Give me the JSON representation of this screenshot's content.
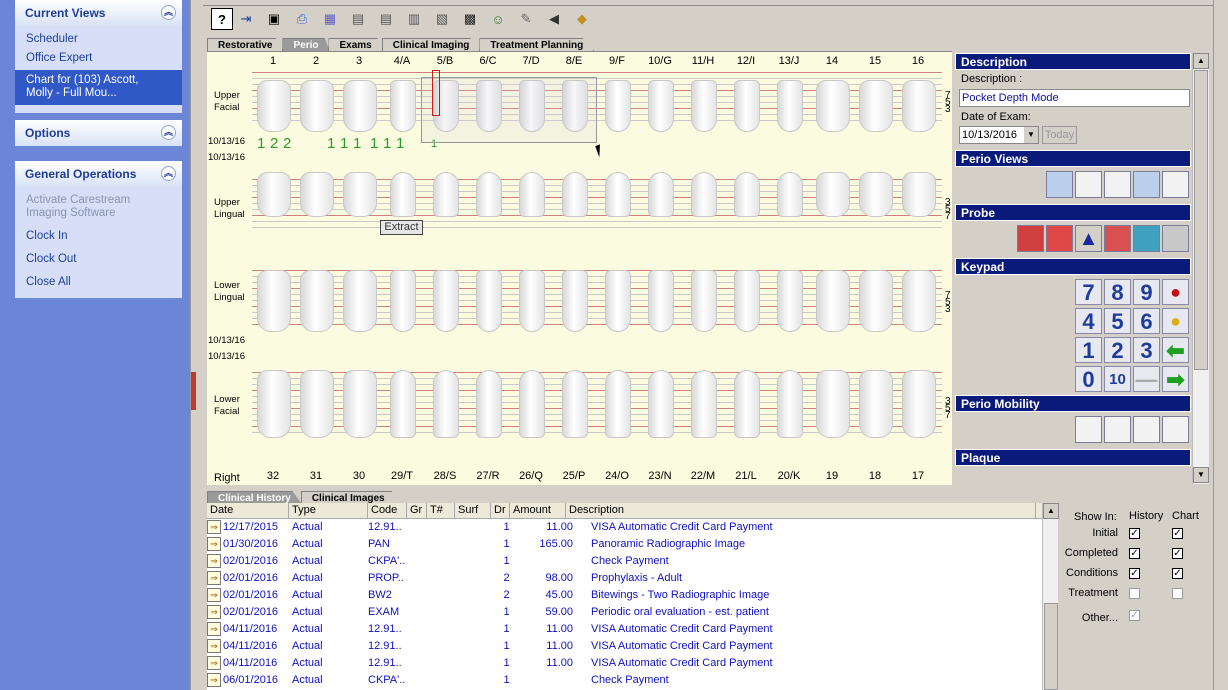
{
  "sidebar": {
    "current_views": {
      "title": "Current Views",
      "items": [
        "Scheduler",
        "Office Expert",
        "Chart for (103) Ascott, Molly - Full Mou..."
      ]
    },
    "options": {
      "title": "Options"
    },
    "general_operations": {
      "title": "General Operations",
      "items": [
        "Activate Carestream Imaging Software",
        "Clock In",
        "Clock Out",
        "Close All"
      ]
    }
  },
  "toolbar": {
    "help": "?"
  },
  "chart_tabs": [
    "Restorative",
    "Perio",
    "Exams",
    "Clinical Imaging",
    "Treatment Planning"
  ],
  "chart": {
    "upper_numbers": [
      "1",
      "2",
      "3",
      "4/A",
      "5/B",
      "6/C",
      "7/D",
      "8/E",
      "9/F",
      "10/G",
      "11/H",
      "12/I",
      "13/J",
      "14",
      "15",
      "16"
    ],
    "lower_numbers": [
      "32",
      "31",
      "30",
      "29/T",
      "28/S",
      "27/R",
      "26/Q",
      "25/P",
      "24/O",
      "23/N",
      "22/M",
      "21/L",
      "20/K",
      "19",
      "18",
      "17"
    ],
    "right_label": "Right",
    "upper_facial": "Upper\nFacial",
    "upper_lingual": "Upper\nLingual",
    "lower_lingual": "Lower\nLingual",
    "lower_facial": "Lower\nFacial",
    "dates": [
      "10/13/16",
      "10/13/16",
      "10/13/16",
      "10/13/16"
    ],
    "green_numbers": [
      "1",
      "2",
      "2",
      "1",
      "1",
      "1",
      "1",
      "1",
      "1",
      "1"
    ],
    "right_nums_a": [
      "7",
      "5",
      "3"
    ],
    "right_nums_b": [
      "3",
      "5",
      "7"
    ],
    "extract": "Extract"
  },
  "right_panel": {
    "description_title": "Description",
    "description_label": "Description :",
    "description_value": "Pocket Depth Mode",
    "date_label": "Date of Exam:",
    "date_value": "10/13/2016",
    "today_label": "Today",
    "perio_views": "Perio Views",
    "probe": "Probe",
    "keypad": "Keypad",
    "keys": [
      "7",
      "8",
      "9",
      "4",
      "5",
      "6",
      "1",
      "2",
      "3",
      "0",
      "10"
    ],
    "perio_mobility": "Perio Mobility",
    "plaque": "Plaque"
  },
  "history_tabs": [
    "Clinical History",
    "Clinical Images"
  ],
  "history": {
    "columns": [
      "Date",
      "Type",
      "Code",
      "Gr",
      "T#",
      "Surf",
      "Dr",
      "Amount",
      "Description"
    ],
    "rows": [
      [
        "12/17/2015",
        "Actual",
        "12.91..",
        "",
        "",
        "",
        "1",
        "11.00",
        "VISA Automatic Credit Card Payment"
      ],
      [
        "01/30/2016",
        "Actual",
        "PAN",
        "",
        "",
        "",
        "1",
        "165.00",
        "Panoramic Radiographic Image"
      ],
      [
        "02/01/2016",
        "Actual",
        "CKPA'..",
        "",
        "",
        "",
        "1",
        "",
        "Check Payment"
      ],
      [
        "02/01/2016",
        "Actual",
        "PROP..",
        "",
        "",
        "",
        "2",
        "98.00",
        "Prophylaxis - Adult"
      ],
      [
        "02/01/2016",
        "Actual",
        "BW2",
        "",
        "",
        "",
        "2",
        "45.00",
        "Bitewings - Two Radiographic Image"
      ],
      [
        "02/01/2016",
        "Actual",
        "EXAM",
        "",
        "",
        "",
        "1",
        "59.00",
        "Periodic oral evaluation - est. patient"
      ],
      [
        "04/11/2016",
        "Actual",
        "12.91..",
        "",
        "",
        "",
        "1",
        "11.00",
        "VISA Automatic Credit Card Payment"
      ],
      [
        "04/11/2016",
        "Actual",
        "12.91..",
        "",
        "",
        "",
        "1",
        "11.00",
        "VISA Automatic Credit Card Payment"
      ],
      [
        "04/11/2016",
        "Actual",
        "12.91..",
        "",
        "",
        "",
        "1",
        "11.00",
        "VISA Automatic Credit Card Payment"
      ],
      [
        "06/01/2016",
        "Actual",
        "CKPA'..",
        "",
        "",
        "",
        "1",
        "",
        "Check Payment"
      ]
    ]
  },
  "show_in": {
    "title": "Show In:",
    "col_history": "History",
    "col_chart": "Chart",
    "rows": [
      {
        "label": "Initial",
        "history": true,
        "chart": true
      },
      {
        "label": "Completed",
        "history": true,
        "chart": true
      },
      {
        "label": "Conditions",
        "history": true,
        "chart": true
      },
      {
        "label": "Treatment",
        "history": false,
        "chart": false
      },
      {
        "label": "Other...",
        "history": true,
        "chart": null
      }
    ]
  }
}
